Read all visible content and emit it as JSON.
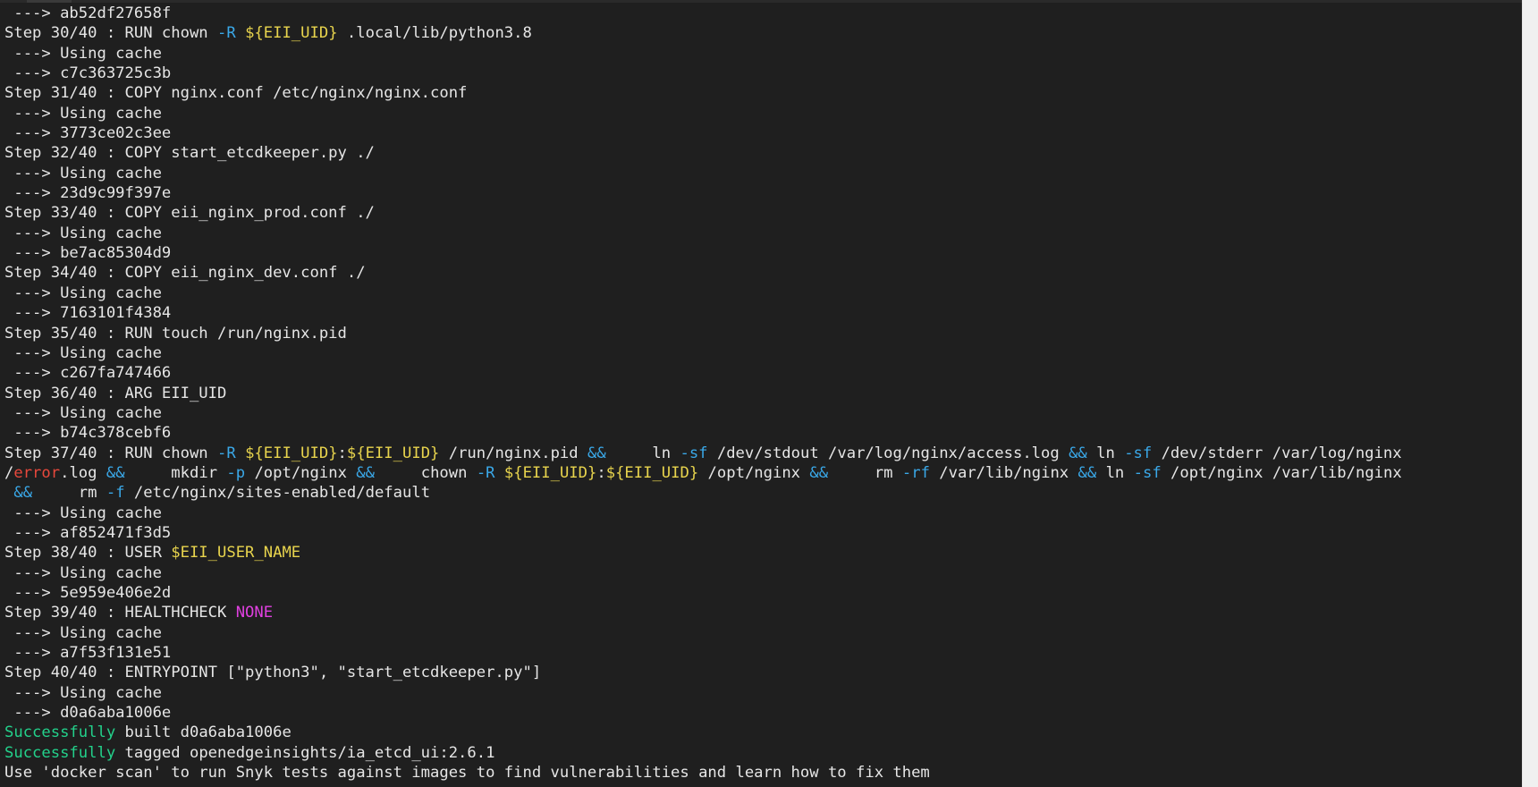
{
  "colors": {
    "background": "#1f1f1f",
    "text": "#e6e6e6",
    "flag": "#3aa8e8",
    "variable": "#e8d44d",
    "operator": "#3aa8e8",
    "error_word": "#e8483c",
    "keyword_none": "#e040e0",
    "success": "#23d18b"
  },
  "terminal": {
    "lines": [
      [
        {
          "t": " ---> ab52df27658f",
          "c": "plain"
        }
      ],
      [
        {
          "t": "Step 30/40 : RUN chown ",
          "c": "plain"
        },
        {
          "t": "-R",
          "c": "flag"
        },
        {
          "t": " ",
          "c": "plain"
        },
        {
          "t": "${EII_UID}",
          "c": "var"
        },
        {
          "t": " .local/lib/python3.8",
          "c": "plain"
        }
      ],
      [
        {
          "t": " ---> Using cache",
          "c": "plain"
        }
      ],
      [
        {
          "t": " ---> c7c363725c3b",
          "c": "plain"
        }
      ],
      [
        {
          "t": "Step 31/40 : COPY nginx.conf /etc/nginx/nginx.conf",
          "c": "plain"
        }
      ],
      [
        {
          "t": " ---> Using cache",
          "c": "plain"
        }
      ],
      [
        {
          "t": " ---> 3773ce02c3ee",
          "c": "plain"
        }
      ],
      [
        {
          "t": "Step 32/40 : COPY start_etcdkeeper.py ./",
          "c": "plain"
        }
      ],
      [
        {
          "t": " ---> Using cache",
          "c": "plain"
        }
      ],
      [
        {
          "t": " ---> 23d9c99f397e",
          "c": "plain"
        }
      ],
      [
        {
          "t": "Step 33/40 : COPY eii_nginx_prod.conf ./",
          "c": "plain"
        }
      ],
      [
        {
          "t": " ---> Using cache",
          "c": "plain"
        }
      ],
      [
        {
          "t": " ---> be7ac85304d9",
          "c": "plain"
        }
      ],
      [
        {
          "t": "Step 34/40 : COPY eii_nginx_dev.conf ./",
          "c": "plain"
        }
      ],
      [
        {
          "t": " ---> Using cache",
          "c": "plain"
        }
      ],
      [
        {
          "t": " ---> 7163101f4384",
          "c": "plain"
        }
      ],
      [
        {
          "t": "Step 35/40 : RUN touch /run/nginx.pid",
          "c": "plain"
        }
      ],
      [
        {
          "t": " ---> Using cache",
          "c": "plain"
        }
      ],
      [
        {
          "t": " ---> c267fa747466",
          "c": "plain"
        }
      ],
      [
        {
          "t": "Step 36/40 : ARG EII_UID",
          "c": "plain"
        }
      ],
      [
        {
          "t": " ---> Using cache",
          "c": "plain"
        }
      ],
      [
        {
          "t": " ---> b74c378cebf6",
          "c": "plain"
        }
      ],
      [
        {
          "t": "Step 37/40 : RUN chown ",
          "c": "plain"
        },
        {
          "t": "-R",
          "c": "flag"
        },
        {
          "t": " ",
          "c": "plain"
        },
        {
          "t": "${EII_UID}",
          "c": "var"
        },
        {
          "t": ":",
          "c": "plain"
        },
        {
          "t": "${EII_UID}",
          "c": "var"
        },
        {
          "t": " /run/nginx.pid ",
          "c": "plain"
        },
        {
          "t": "&&",
          "c": "op"
        },
        {
          "t": "     ln ",
          "c": "plain"
        },
        {
          "t": "-sf",
          "c": "flag"
        },
        {
          "t": " /dev/stdout /var/log/nginx/access.log ",
          "c": "plain"
        },
        {
          "t": "&&",
          "c": "op"
        },
        {
          "t": " ln ",
          "c": "plain"
        },
        {
          "t": "-sf",
          "c": "flag"
        },
        {
          "t": " /dev/stderr /var/log/nginx",
          "c": "plain"
        }
      ],
      [
        {
          "t": "/",
          "c": "plain"
        },
        {
          "t": "error",
          "c": "err"
        },
        {
          "t": ".log ",
          "c": "plain"
        },
        {
          "t": "&&",
          "c": "op"
        },
        {
          "t": "     mkdir ",
          "c": "plain"
        },
        {
          "t": "-p",
          "c": "flag"
        },
        {
          "t": " /opt/nginx ",
          "c": "plain"
        },
        {
          "t": "&&",
          "c": "op"
        },
        {
          "t": "     chown ",
          "c": "plain"
        },
        {
          "t": "-R",
          "c": "flag"
        },
        {
          "t": " ",
          "c": "plain"
        },
        {
          "t": "${EII_UID}",
          "c": "var"
        },
        {
          "t": ":",
          "c": "plain"
        },
        {
          "t": "${EII_UID}",
          "c": "var"
        },
        {
          "t": " /opt/nginx ",
          "c": "plain"
        },
        {
          "t": "&&",
          "c": "op"
        },
        {
          "t": "     rm ",
          "c": "plain"
        },
        {
          "t": "-rf",
          "c": "flag"
        },
        {
          "t": " /var/lib/nginx ",
          "c": "plain"
        },
        {
          "t": "&&",
          "c": "op"
        },
        {
          "t": " ln ",
          "c": "plain"
        },
        {
          "t": "-sf",
          "c": "flag"
        },
        {
          "t": " /opt/nginx /var/lib/nginx",
          "c": "plain"
        }
      ],
      [
        {
          "t": " ",
          "c": "plain"
        },
        {
          "t": "&&",
          "c": "op"
        },
        {
          "t": "     rm ",
          "c": "plain"
        },
        {
          "t": "-f",
          "c": "flag"
        },
        {
          "t": " /etc/nginx/sites-enabled/default",
          "c": "plain"
        }
      ],
      [
        {
          "t": " ---> Using cache",
          "c": "plain"
        }
      ],
      [
        {
          "t": " ---> af852471f3d5",
          "c": "plain"
        }
      ],
      [
        {
          "t": "Step 38/40 : USER ",
          "c": "plain"
        },
        {
          "t": "$EII_USER_NAME",
          "c": "var"
        }
      ],
      [
        {
          "t": " ---> Using cache",
          "c": "plain"
        }
      ],
      [
        {
          "t": " ---> 5e959e406e2d",
          "c": "plain"
        }
      ],
      [
        {
          "t": "Step 39/40 : HEALTHCHECK ",
          "c": "plain"
        },
        {
          "t": "NONE",
          "c": "none"
        }
      ],
      [
        {
          "t": " ---> Using cache",
          "c": "plain"
        }
      ],
      [
        {
          "t": " ---> a7f53f131e51",
          "c": "plain"
        }
      ],
      [
        {
          "t": "Step 40/40 : ENTRYPOINT [\"python3\", \"start_etcdkeeper.py\"]",
          "c": "plain"
        }
      ],
      [
        {
          "t": " ---> Using cache",
          "c": "plain"
        }
      ],
      [
        {
          "t": " ---> d0a6aba1006e",
          "c": "plain"
        }
      ],
      [
        {
          "t": "Successfully",
          "c": "ok"
        },
        {
          "t": " built d0a6aba1006e",
          "c": "plain"
        }
      ],
      [
        {
          "t": "Successfully",
          "c": "ok"
        },
        {
          "t": " tagged openedgeinsights/ia_etcd_ui:2.6.1",
          "c": "plain"
        }
      ],
      [
        {
          "t": "Use 'docker scan' to run Snyk tests against images to find vulnerabilities and learn how to fix them",
          "c": "plain"
        }
      ]
    ]
  }
}
